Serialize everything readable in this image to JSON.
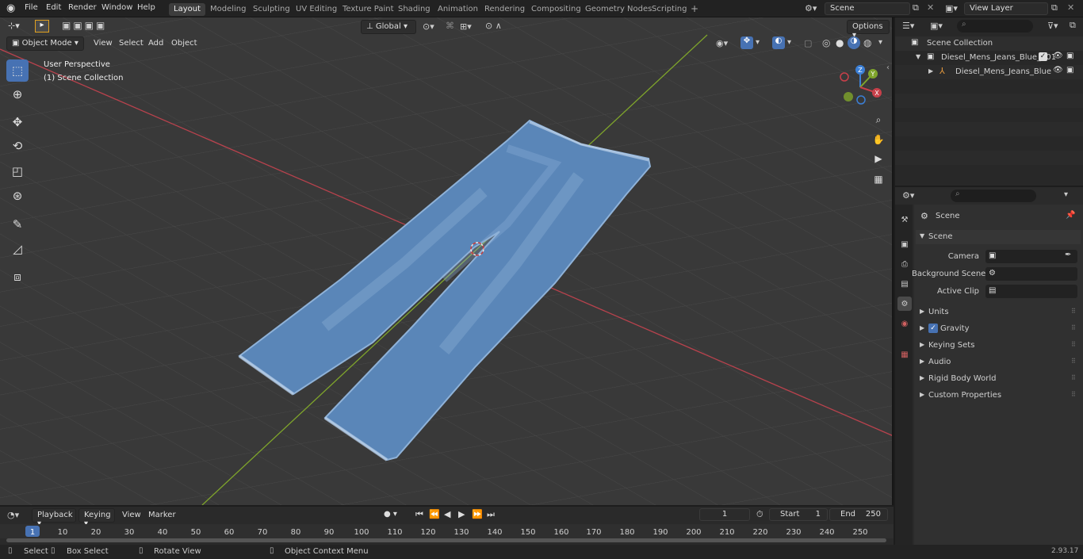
{
  "topbar": {
    "menus": [
      "File",
      "Edit",
      "Render",
      "Window",
      "Help"
    ],
    "workspaces": [
      "Layout",
      "Modeling",
      "Sculpting",
      "UV Editing",
      "Texture Paint",
      "Shading",
      "Animation",
      "Rendering",
      "Compositing",
      "Geometry Nodes",
      "Scripting"
    ],
    "active_workspace": "Layout",
    "scene": "Scene",
    "view_layer": "View Layer"
  },
  "viewport_header": {
    "mode": "Object Mode",
    "menus": [
      "View",
      "Select",
      "Add",
      "Object"
    ],
    "orientation": "Global",
    "options": "Options"
  },
  "viewport": {
    "perspective": "User Perspective",
    "collection": "(1) Scene Collection",
    "gizmo_axes": [
      "X",
      "Y",
      "Z"
    ]
  },
  "outliner": {
    "root": "Scene Collection",
    "items": [
      {
        "label": "Diesel_Mens_Jeans_Blue_001"
      },
      {
        "label": "Diesel_Mens_Jeans_Blue"
      }
    ]
  },
  "properties": {
    "context": "Scene",
    "panel": "Scene",
    "fields": [
      {
        "label": "Camera",
        "value": ""
      },
      {
        "label": "Background Scene",
        "value": ""
      },
      {
        "label": "Active Clip",
        "value": ""
      }
    ],
    "subpanels": [
      "Units",
      "Gravity",
      "Keying Sets",
      "Audio",
      "Rigid Body World",
      "Custom Properties"
    ]
  },
  "timeline": {
    "menus": [
      "Playback",
      "Keying",
      "View",
      "Marker"
    ],
    "current_frame": "1",
    "start_label": "Start",
    "start": "1",
    "end_label": "End",
    "end": "250",
    "ticks": [
      "1",
      "10",
      "20",
      "30",
      "40",
      "50",
      "60",
      "70",
      "80",
      "90",
      "100",
      "110",
      "120",
      "130",
      "140",
      "150",
      "160",
      "170",
      "180",
      "190",
      "200",
      "210",
      "220",
      "230",
      "240",
      "250"
    ]
  },
  "statusbar": {
    "select": "Select",
    "box_select": "Box Select",
    "rotate_view": "Rotate View",
    "context_menu": "Object Context Menu",
    "version": "2.93.17"
  },
  "colors": {
    "accent": "#4772b3",
    "x_axis": "#c8404a",
    "y_axis": "#7fa52b",
    "z_axis": "#3b7fd6",
    "viewport_bg": "#3b3b3b",
    "denim": "#5a86b8"
  }
}
